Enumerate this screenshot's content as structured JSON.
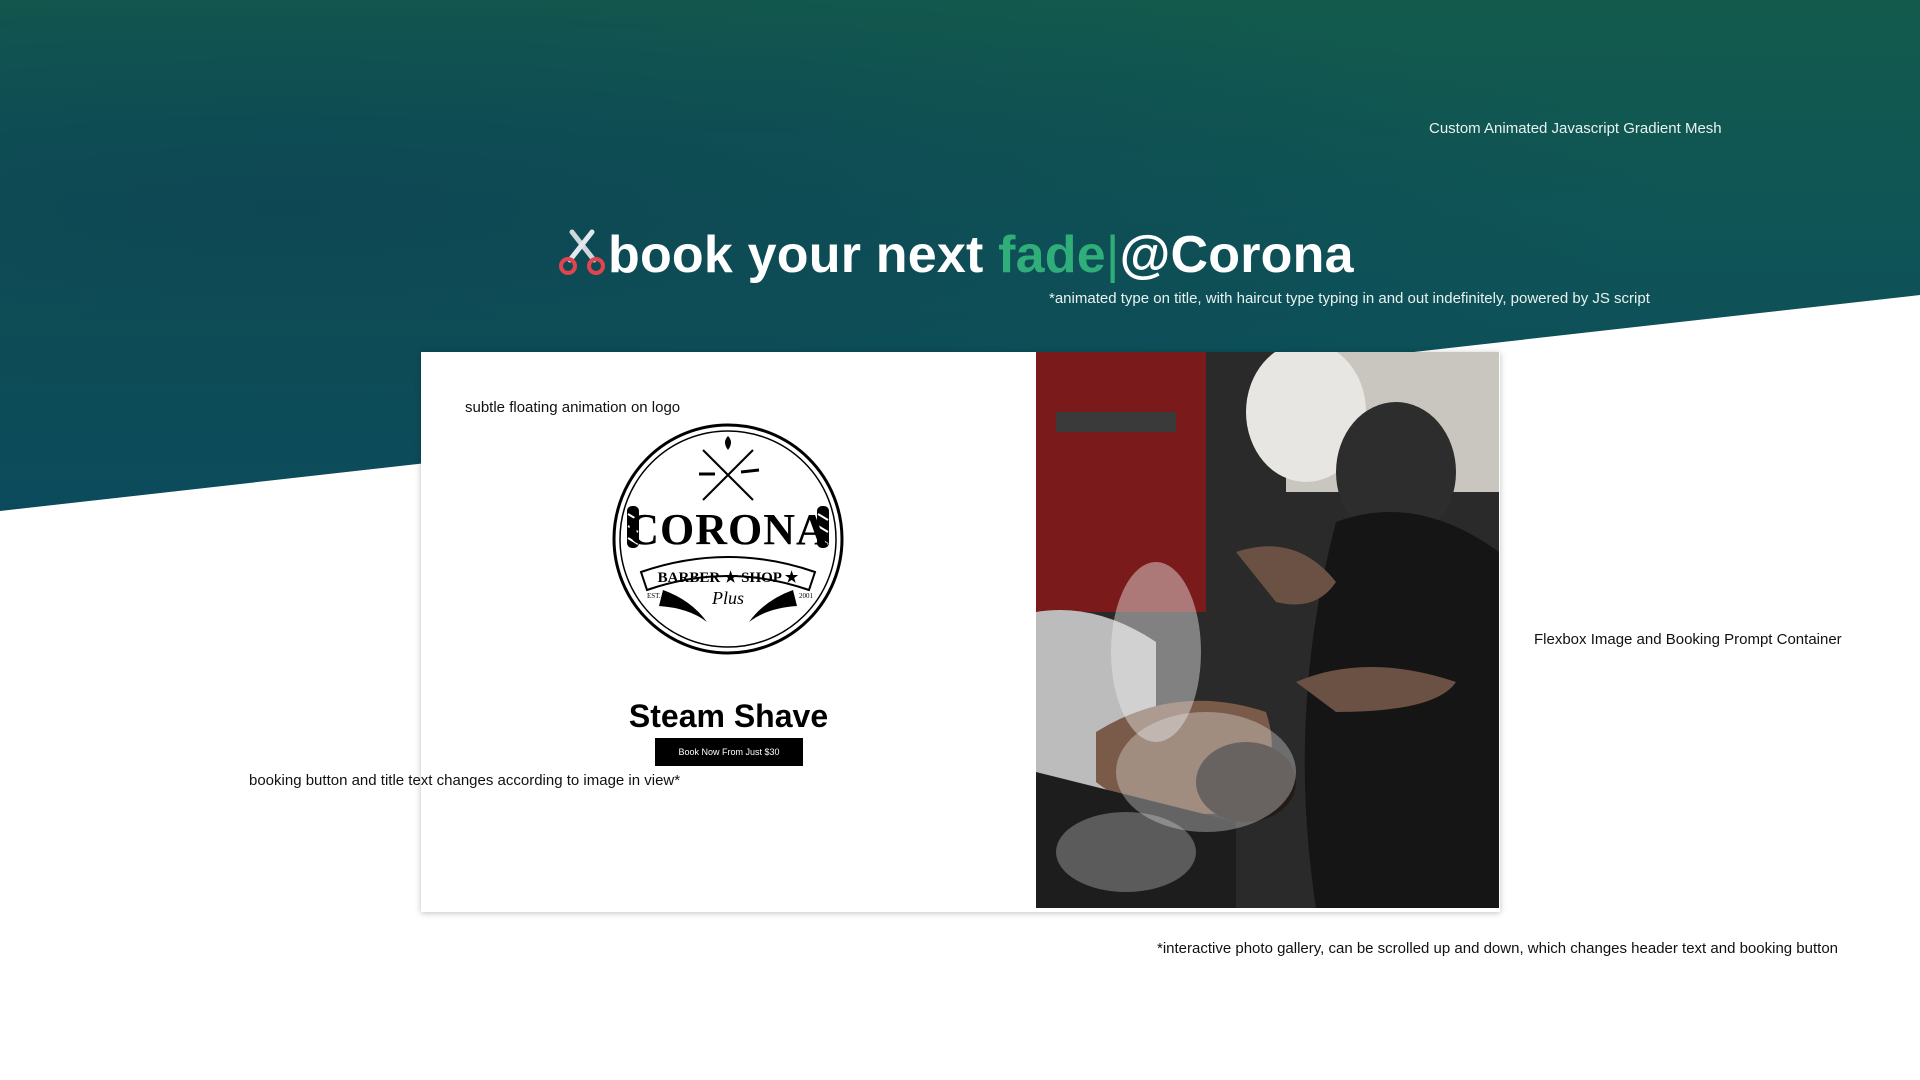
{
  "annotations": {
    "gradient_mesh": "Custom Animated Javascript Gradient Mesh",
    "animated_type": "*animated type on title, with haircut type typing in and out indefinitely, powered by JS script",
    "floating_logo": "subtle floating animation on logo",
    "flexbox_container": "Flexbox Image and Booking Prompt Container",
    "booking_changes": "booking button and title text changes according to image in view*",
    "photo_gallery": "*interactive photo gallery, can be scrolled up and down, which changes header text and booking button"
  },
  "headline": {
    "prefix": "book your next ",
    "typed_word": "fade",
    "cursor": "|",
    "suffix": "@Corona",
    "icon": "scissors-icon"
  },
  "logo": {
    "name": "CORONA",
    "subtitle": "BARBER ★ SHOP ★",
    "script": "Plus",
    "est": "EST.",
    "year": "2001"
  },
  "card": {
    "title": "Steam Shave",
    "button_label": "Book Now From Just $30"
  },
  "colors": {
    "accent": "#2fae7a",
    "hero_top": "#135a4c",
    "hero_bottom": "#0b4a5c"
  }
}
